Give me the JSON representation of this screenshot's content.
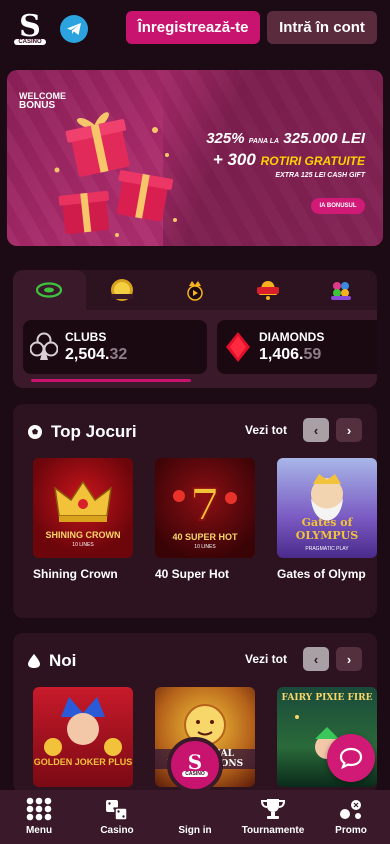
{
  "header": {
    "logo_letter": "S",
    "logo_tag": "CASINO",
    "register_label": "Înregistrează-te",
    "login_label": "Intră în cont"
  },
  "banner": {
    "welcome_line1": "WELCOME",
    "welcome_line2": "BONUS",
    "percent": "325%",
    "upto_small": "PANA LA",
    "amount": "325.000 LEI",
    "plus_spins": "+ 300",
    "spins_label": "ROTIRI GRATUITE",
    "extra": "EXTRA 125 LEI CASH GIFT",
    "cta": "IA BONUSUL"
  },
  "jackpot": {
    "tabs": [
      {
        "label": "EGT"
      },
      {
        "label": "GOLDEN COINS LINK"
      },
      {
        "label": "PLAY"
      },
      {
        "label": "BELL"
      },
      {
        "label": "CLOVER"
      }
    ],
    "cards": [
      {
        "name": "CLUBS",
        "value_main": "2,504.",
        "value_dec": "32"
      },
      {
        "name": "DIAMONDS",
        "value_main": "1,406.",
        "value_dec": "59"
      }
    ]
  },
  "top_games": {
    "title": "Top Jocuri",
    "see_all": "Vezi tot",
    "games": [
      {
        "name": "Shining Crown",
        "art": "SHINING CROWN",
        "sub": "10 LINES"
      },
      {
        "name": "40 Super Hot",
        "art": "40 SUPER HOT",
        "sub": "10 LINES"
      },
      {
        "name": "Gates of Olymp",
        "art": "Gates of OLYMPUS",
        "sub": "PRAGMATIC PLAY"
      }
    ]
  },
  "new_games": {
    "title": "Noi",
    "see_all": "Vezi tot",
    "games": [
      {
        "art": "GOLDEN JOKER PLUS"
      },
      {
        "art": "CELESTIAL REVOLUTIONS"
      },
      {
        "art": "FAIRY PIXIE FIRE"
      }
    ]
  },
  "bottom_nav": {
    "menu": "Menu",
    "casino": "Casino",
    "signin": "Sign in",
    "tournaments": "Tournamente",
    "promo": "Promo"
  },
  "colors": {
    "background": "#1c0a14",
    "accent": "#c8146f",
    "panel": "#2d1320"
  }
}
